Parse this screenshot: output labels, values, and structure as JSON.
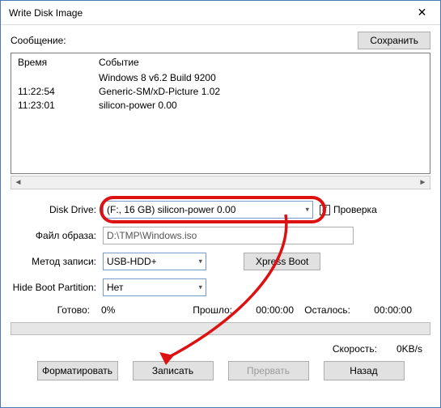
{
  "window": {
    "title": "Write Disk Image"
  },
  "message": {
    "label": "Сообщение:",
    "save_label": "Сохранить"
  },
  "log": {
    "headers": {
      "time": "Время",
      "event": "Событие"
    },
    "rows": [
      {
        "time": "",
        "event": "Windows 8 v6.2 Build 9200"
      },
      {
        "time": "11:22:54",
        "event": "Generic-SM/xD-Picture   1.02"
      },
      {
        "time": "11:23:01",
        "event": "silicon-power   0.00",
        "indent": true
      }
    ]
  },
  "form": {
    "disk_drive_label": "Disk Drive:",
    "disk_drive_value": "(F:, 16 GB)     silicon-power   0.00",
    "check_label": "Проверка",
    "image_label": "Файл образа:",
    "image_value": "D:\\TMP\\Windows.iso",
    "method_label": "Метод записи:",
    "method_value": "USB-HDD+",
    "xpress_label": "Xpress Boot",
    "hide_label": "Hide Boot Partition:",
    "hide_value": "Нет"
  },
  "status": {
    "ready_label": "Готово:",
    "ready_value": "0%",
    "elapsed_label": "Прошло:",
    "elapsed_value": "00:00:00",
    "remaining_label": "Осталось:",
    "remaining_value": "00:00:00",
    "speed_label": "Скорость:",
    "speed_value": "0KB/s"
  },
  "buttons": {
    "format": "Форматировать",
    "write": "Записать",
    "abort": "Прервать",
    "back": "Назад"
  }
}
